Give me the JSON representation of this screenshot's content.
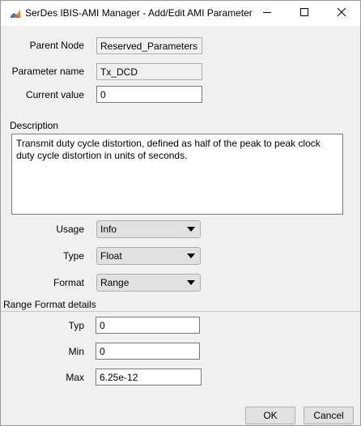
{
  "window": {
    "title": "SerDes IBIS-AMI Manager - Add/Edit AMI Parameter",
    "icon": "matlab-logo-icon",
    "controls": [
      "minimize-icon",
      "maximize-icon",
      "close-icon"
    ]
  },
  "form": {
    "parent_node": {
      "label": "Parent Node",
      "value": "Reserved_Parameters"
    },
    "parameter_name": {
      "label": "Parameter name",
      "value": "Tx_DCD"
    },
    "current_value": {
      "label": "Current value",
      "value": "0"
    },
    "description": {
      "label": "Description",
      "line1": "Transmit duty cycle distortion, defined as half of the peak to peak clock",
      "line2": "duty cycle distortion in units of seconds."
    },
    "usage": {
      "label": "Usage",
      "value": "Info"
    },
    "type": {
      "label": "Type",
      "value": "Float"
    },
    "format": {
      "label": "Format",
      "value": "Range"
    }
  },
  "range_details": {
    "heading": "Range Format details",
    "typ": {
      "label": "Typ",
      "value": "0"
    },
    "min": {
      "label": "Min",
      "value": "0"
    },
    "max": {
      "label": "Max",
      "value": "6.25e-12"
    }
  },
  "buttons": {
    "ok": "OK",
    "cancel": "Cancel"
  }
}
